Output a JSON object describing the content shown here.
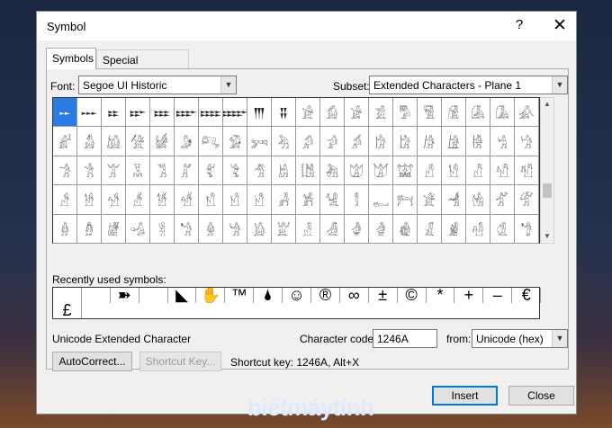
{
  "window": {
    "title": "Symbol",
    "help": "?",
    "close": "✕"
  },
  "tabs": [
    {
      "label": "Symbols"
    },
    {
      "label": "Special Characters"
    }
  ],
  "font": {
    "label": "Font:",
    "value": "Segoe UI Historic"
  },
  "subset": {
    "label": "Subset:",
    "value": "Extended Characters - Plane 1"
  },
  "symbol_grid": [
    "𒐀",
    "𒐁",
    "𒐂",
    "𒐃",
    "𒐄",
    "𒐅",
    "𒐆",
    "𒐇",
    "𒐈",
    "𒐉",
    "𓀀",
    "𓀁",
    "𓀂",
    "𓀃",
    "𓀄",
    "𓀅",
    "𓀆",
    "𓀇",
    "𓀈",
    "𓀉",
    "𓀊",
    "𓀋",
    "𓀌",
    "𓀍",
    "𓀎",
    "𓀏",
    "𓀐",
    "𓀑",
    "𓀒",
    "𓀓",
    "𓀔",
    "𓀕",
    "𓀖",
    "𓀗",
    "𓀘",
    "𓀙",
    "𓀚",
    "𓀛",
    "𓀜",
    "𓀝",
    "𓀞",
    "𓀟",
    "𓀠",
    "𓀡",
    "𓀢",
    "𓀣",
    "𓀤",
    "𓀥",
    "𓀦",
    "𓀧",
    "𓀨",
    "𓀩",
    "𓀪",
    "𓀫",
    "𓀬",
    "𓀭",
    "𓀮",
    "𓀯",
    "𓀰",
    "𓀱",
    "𓀲",
    "𓀳",
    "𓀴",
    "𓀵",
    "𓀶",
    "𓀷",
    "𓀸",
    "𓀹",
    "𓀺",
    "𓀻",
    "𓀼",
    "𓀽",
    "𓀾",
    "𓀿",
    "𓁀",
    "𓁁",
    "𓁂",
    "𓁃",
    "𓁄",
    "𓁅",
    "𓁆",
    "𓁇",
    "𓁈",
    "𓁉",
    "𓁊",
    "𓁋",
    "𓁌",
    "𓁍",
    "𓁎",
    "𓁏",
    "𓁐",
    "𓁑",
    "𓁒",
    "𓁓",
    "𓁔",
    "𓁕",
    "𓁖",
    "𓁗",
    "𓁘",
    "𓁙"
  ],
  "recent": {
    "label": "Recently used symbols:",
    "items": [
      "",
      "",
      "➽",
      "",
      "◣",
      "✋",
      "™",
      "🌢",
      "☺",
      "®",
      "∞",
      "±",
      "©",
      "*",
      "+",
      "–",
      "€",
      "£"
    ]
  },
  "char_name": "Unicode Extended Character",
  "char_code": {
    "label": "Character code:",
    "value": "1246A"
  },
  "from": {
    "label": "from:",
    "value": "Unicode (hex)"
  },
  "buttons": {
    "autocorrect": "AutoCorrect...",
    "shortcut_key": "Shortcut Key...",
    "insert": "Insert",
    "close": "Close"
  },
  "shortcut_text": "Shortcut key: 1246A, Alt+X",
  "watermark": "biếtmáytính"
}
